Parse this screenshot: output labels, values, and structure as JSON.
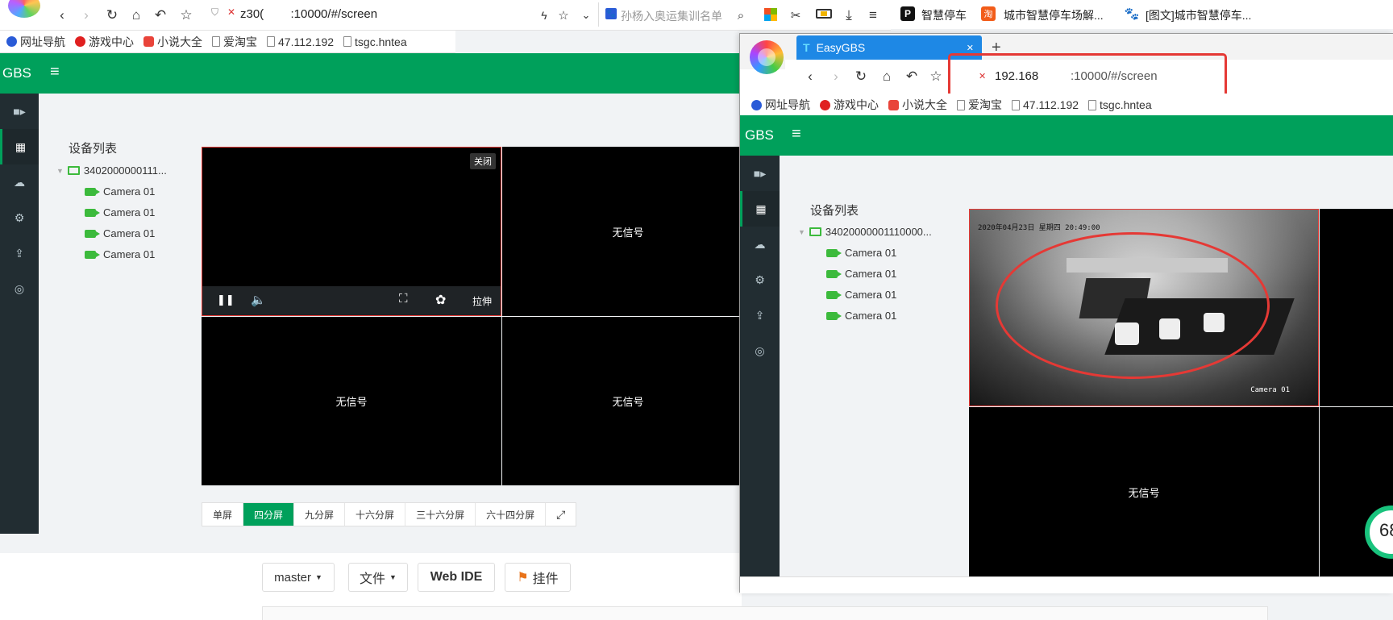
{
  "left_browser": {
    "address": "z30(        :10000/#/screen",
    "search_text": "孙杨入奥运集训名单",
    "top_links": [
      "智慧停车",
      "城市智慧停车场解...",
      "[图文]城市智慧停车..."
    ],
    "bookmarks": [
      "网址导航",
      "游戏中心",
      "小说大全",
      "爱淘宝",
      "47.112.192",
      "tsgc.hntea"
    ]
  },
  "left_app": {
    "logo": "GBS",
    "device_list_title": "设备列表",
    "device_id": "3402000000111...",
    "cameras": [
      "Camera 01",
      "Camera 01",
      "Camera 01",
      "Camera 01"
    ],
    "close_label": "关闭",
    "stretch_label": "拉伸",
    "no_signal": "无信号",
    "split_modes": [
      "单屏",
      "四分屏",
      "九分屏",
      "十六分屏",
      "三十六分屏",
      "六十四分屏"
    ],
    "active_split": "四分屏"
  },
  "gitlab_bar": {
    "branch": "master",
    "file_label": "文件",
    "web_ide": "Web IDE",
    "pendant": "挂件"
  },
  "right_browser": {
    "tab_title": "EasyGBS",
    "address_prefix": "192.168",
    "address_suffix": ":10000/#/screen",
    "bookmarks": [
      "网址导航",
      "游戏中心",
      "小说大全",
      "爱淘宝",
      "47.112.192",
      "tsgc.hntea"
    ]
  },
  "right_app": {
    "logo": "GBS",
    "device_list_title": "设备列表",
    "device_id": "34020000001110000...",
    "cameras": [
      "Camera 01",
      "Camera 01",
      "Camera 01",
      "Camera 01"
    ],
    "video_timestamp": "2020年04月23日 星期四 20:49:00",
    "video_caption": "Camera 01",
    "no_signal": "无信号",
    "corner_badge": "68"
  },
  "colors": {
    "brand_green": "#00a05b",
    "sidebar_dark": "#222d32",
    "highlight_red": "#e53935"
  }
}
